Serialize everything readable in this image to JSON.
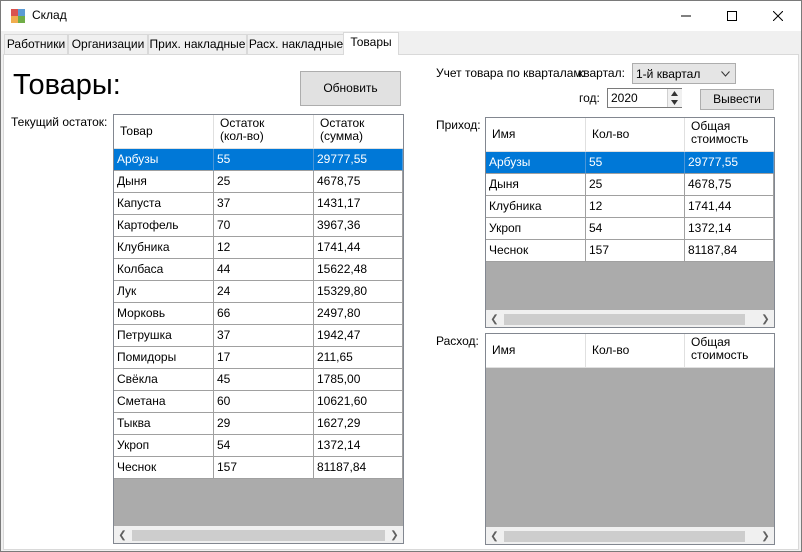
{
  "window": {
    "title": "Склад"
  },
  "tabs": [
    "Работники",
    "Организации",
    "Прих. накладные",
    "Расх. накладные",
    "Товары"
  ],
  "page": {
    "title": "Товары:",
    "refresh_label": "Обновить",
    "current_stock_label": "Текущий остаток:"
  },
  "stock_table": {
    "headers": [
      "Товар",
      "Остаток\n(кол-во)",
      "Остаток\n(сумма)"
    ],
    "rows": [
      [
        "Арбузы",
        "55",
        "29777,55"
      ],
      [
        "Дыня",
        "25",
        "4678,75"
      ],
      [
        "Капуста",
        "37",
        "1431,17"
      ],
      [
        "Картофель",
        "70",
        "3967,36"
      ],
      [
        "Клубника",
        "12",
        "1741,44"
      ],
      [
        "Колбаса",
        "44",
        "15622,48"
      ],
      [
        "Лук",
        "24",
        "15329,80"
      ],
      [
        "Морковь",
        "66",
        "2497,80"
      ],
      [
        "Петрушка",
        "37",
        "1942,47"
      ],
      [
        "Помидоры",
        "17",
        "211,65"
      ],
      [
        "Свёкла",
        "45",
        "1785,00"
      ],
      [
        "Сметана",
        "60",
        "10621,60"
      ],
      [
        "Тыква",
        "29",
        "1627,29"
      ],
      [
        "Укроп",
        "54",
        "1372,14"
      ],
      [
        "Чеснок",
        "157",
        "81187,84"
      ]
    ]
  },
  "quarter": {
    "label": "Учет товара по кварталам:",
    "quarter_label": "квартал:",
    "quarter_value": "1-й квартал",
    "year_label": "год:",
    "year_value": "2020",
    "output_label": "Вывести"
  },
  "income_table": {
    "label": "Приход:",
    "headers": [
      "Имя",
      "Кол-во",
      "Общая\nстоимость"
    ],
    "rows": [
      [
        "Арбузы",
        "55",
        "29777,55"
      ],
      [
        "Дыня",
        "25",
        "4678,75"
      ],
      [
        "Клубника",
        "12",
        "1741,44"
      ],
      [
        "Укроп",
        "54",
        "1372,14"
      ],
      [
        "Чеснок",
        "157",
        "81187,84"
      ]
    ]
  },
  "expense_table": {
    "label": "Расход:",
    "headers": [
      "Имя",
      "Кол-во",
      "Общая\nстоимость"
    ],
    "rows": []
  },
  "colors": {
    "selection": "#0078d7",
    "grid_bg": "#ababab",
    "window_bg": "#f0f0f0"
  },
  "icons": {
    "app": "warehouse-icon",
    "minimize": "minimize-icon",
    "maximize": "maximize-icon",
    "close": "close-icon"
  }
}
